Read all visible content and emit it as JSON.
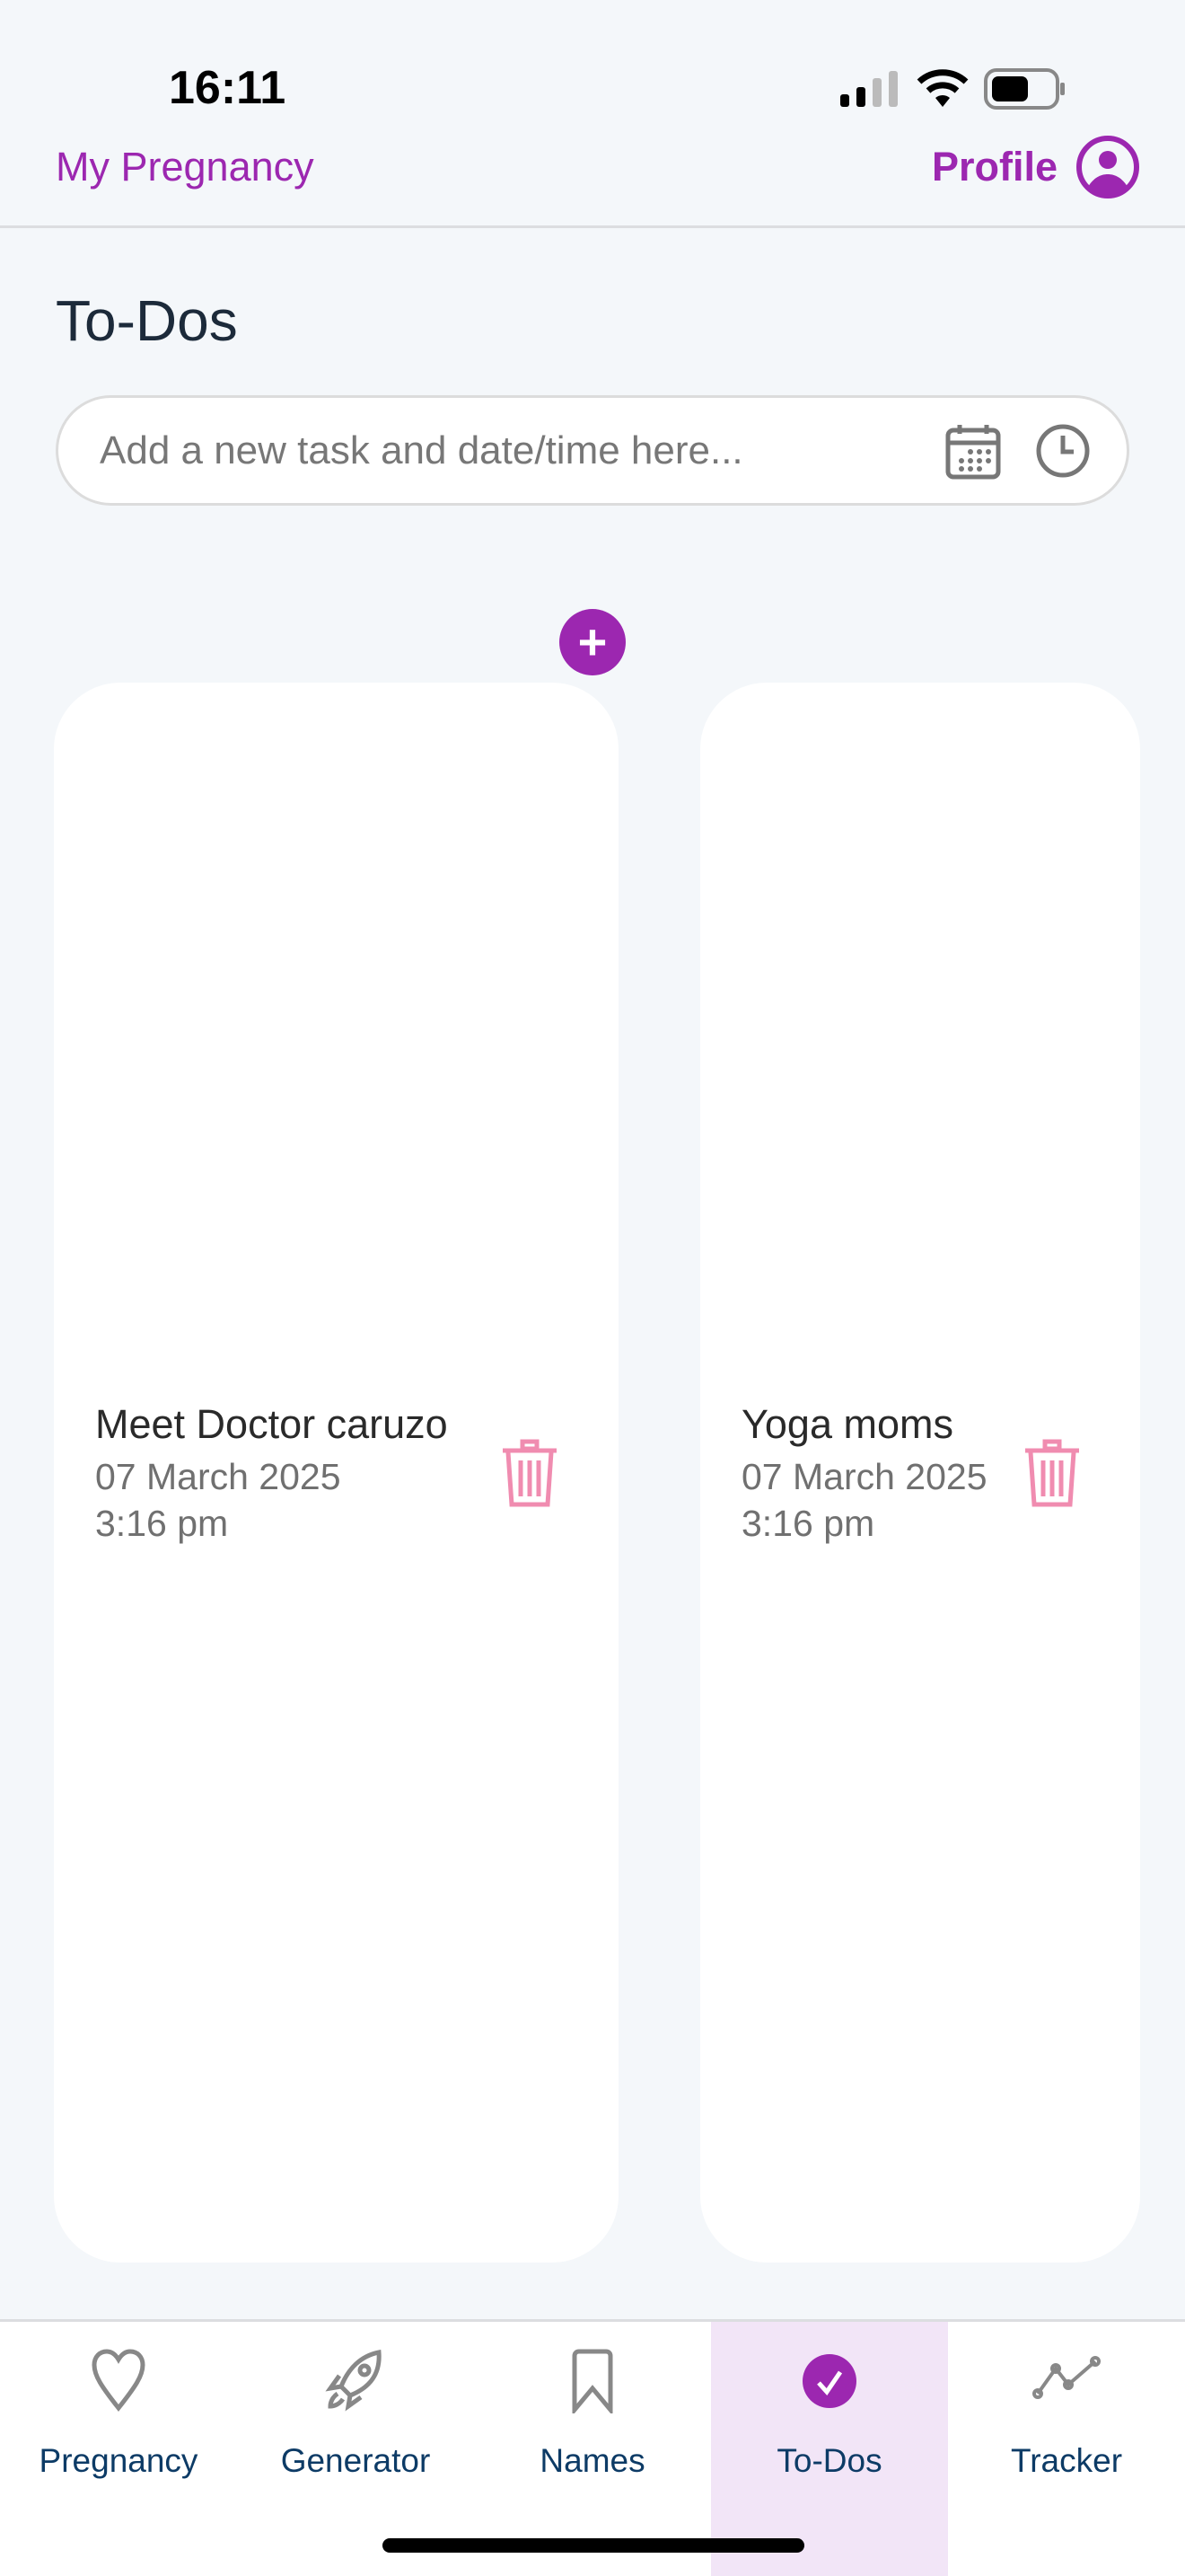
{
  "status_bar": {
    "time": "16:11"
  },
  "header": {
    "app_name": "My Pregnancy",
    "profile_label": "Profile"
  },
  "page": {
    "title": "To-Dos"
  },
  "task_input": {
    "placeholder": "Add a new task and date/time here...",
    "value": ""
  },
  "todos": [
    {
      "title": "Meet Doctor caruzo",
      "date": "07 March 2025",
      "time": "3:16 pm"
    },
    {
      "title": "Yoga moms",
      "date": "07 March 2025",
      "time": "3:16 pm"
    }
  ],
  "nav": {
    "tabs": [
      {
        "label": "Pregnancy",
        "icon": "heart-icon"
      },
      {
        "label": "Generator",
        "icon": "rocket-icon"
      },
      {
        "label": "Names",
        "icon": "bookmark-icon"
      },
      {
        "label": "To-Dos",
        "icon": "check-circle-icon",
        "selected": true
      },
      {
        "label": "Tracker",
        "icon": "chart-line-icon"
      }
    ]
  },
  "colors": {
    "accent": "#9c27b0",
    "trash": "#f08cb0",
    "nav_text": "#0d3b66",
    "selected_tab_bg": "#f2e5f7"
  }
}
